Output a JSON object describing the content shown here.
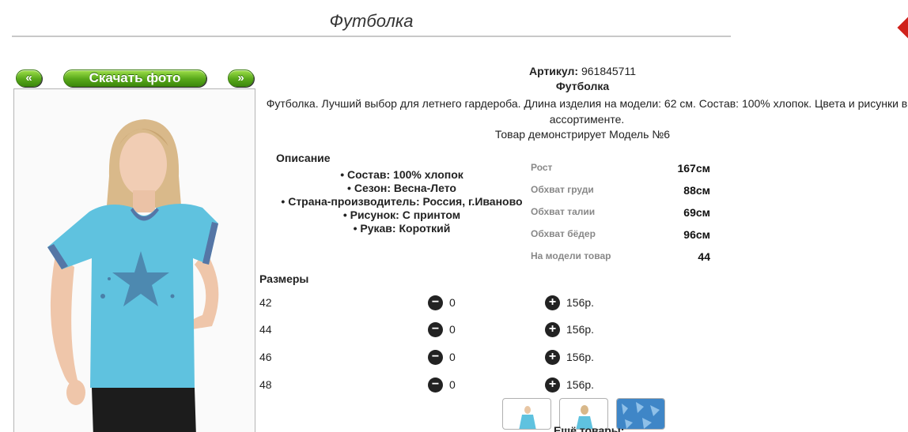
{
  "page": {
    "title": "Футболка"
  },
  "nav": {
    "prev_label": "«",
    "download_label": "Скачать фото",
    "next_label": "»"
  },
  "product": {
    "sku_label": "Артикул:",
    "sku_value": "961845711",
    "name": "Футболка",
    "description": "Футболка. Лучший выбор для летнего гардероба. Длина изделия на модели: 62 см. Состав: 100% хлопок. Цвета и рисунки в ассортименте.",
    "model_demo": "Товар демонстрирует Модель №6"
  },
  "features": {
    "title": "Описание",
    "items": [
      "Состав: 100% хлопок",
      "Сезон: Весна-Лето",
      "Страна-производитель: Россия, г.Иваново",
      "Рисунок: С принтом",
      "Рукав: Короткий"
    ]
  },
  "params": [
    {
      "label": "Рост",
      "value": "167см"
    },
    {
      "label": "Обхват груди",
      "value": "88см"
    },
    {
      "label": "Обхват талии",
      "value": "69см"
    },
    {
      "label": "Обхват бёдер",
      "value": "96см"
    },
    {
      "label": "На модели товар",
      "value": "44"
    }
  ],
  "sizes": {
    "title": "Размеры",
    "rows": [
      {
        "size": "42",
        "qty": "0",
        "price": "156р."
      },
      {
        "size": "44",
        "qty": "0",
        "price": "156р."
      },
      {
        "size": "46",
        "qty": "0",
        "price": "156р."
      },
      {
        "size": "48",
        "qty": "0",
        "price": "156р."
      }
    ]
  },
  "icons": {
    "minus": "minus-circle-icon",
    "plus": "plus-circle-icon"
  },
  "more_label": "Ещё товары:",
  "colors": {
    "button_green": "#58a81a",
    "shirt_blue": "#5fc2df",
    "corner_red": "#d0211b"
  }
}
